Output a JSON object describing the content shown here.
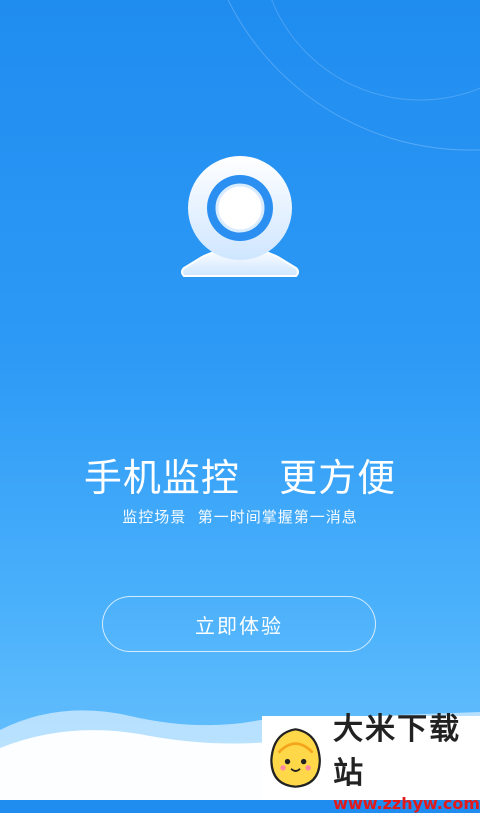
{
  "hero": {
    "headline": "手机监控   更方便",
    "subline": "监控场景  第一时间掌握第一消息"
  },
  "cta": {
    "label": "立即体验"
  },
  "watermark": {
    "name": "大米下载站",
    "url": "www.zzhyw.com"
  },
  "colors": {
    "bg_top": "#1f8cf0",
    "bg_bottom": "#6cc3fd",
    "text": "#ffffff",
    "watermark_url": "#e31a1a"
  },
  "icons": [
    "webcam-icon",
    "mascot-logo"
  ]
}
